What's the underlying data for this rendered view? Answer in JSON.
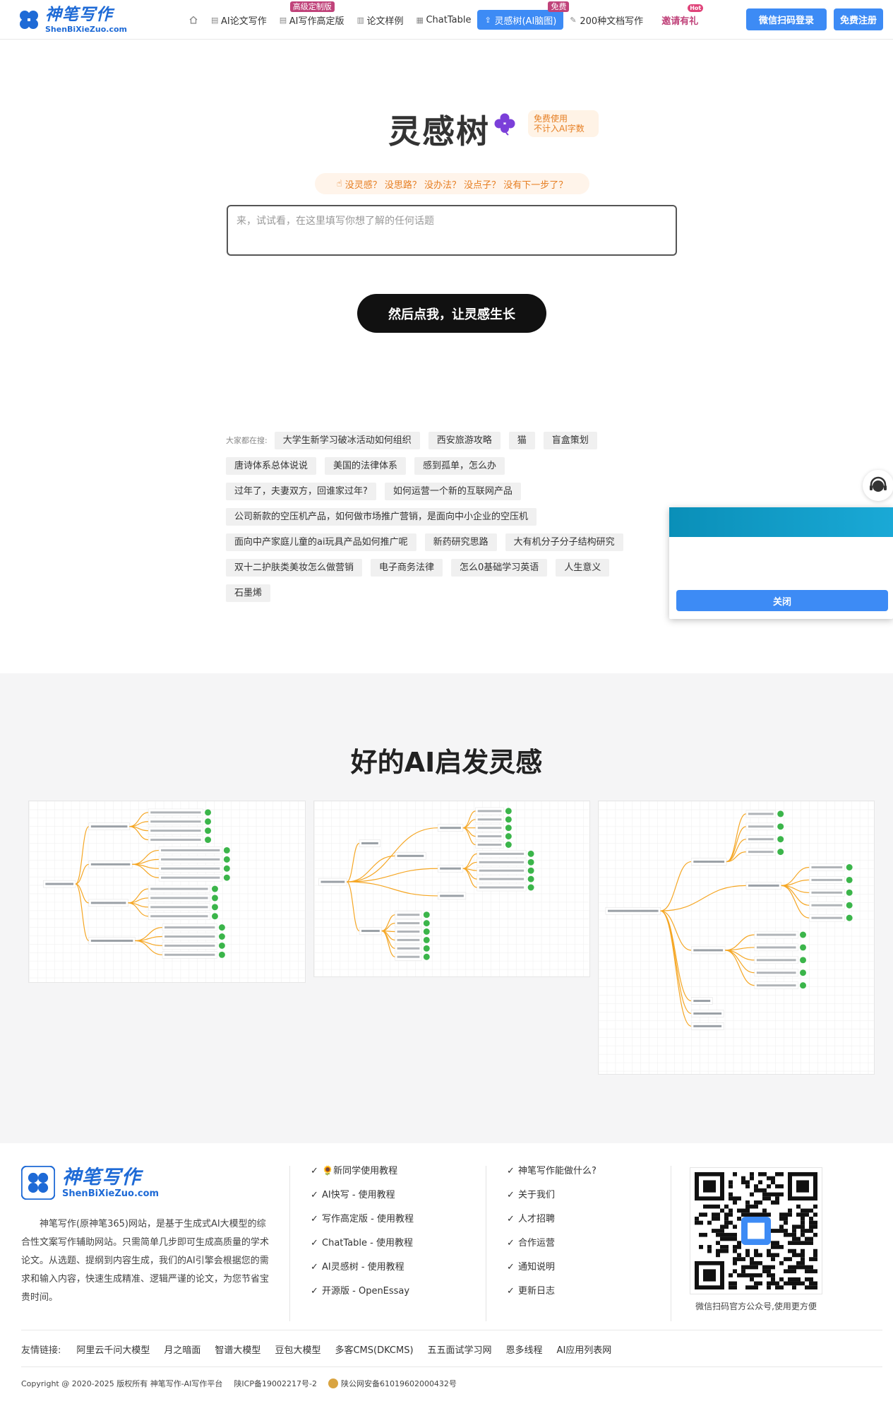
{
  "brand": {
    "name_cn": "神笔写作",
    "name_en": "ShenBiXieZuo.com"
  },
  "nav": {
    "items": [
      {
        "label": "AI论文写作",
        "icon": "document-icon"
      },
      {
        "label": "AI写作高定版",
        "icon": "document-icon",
        "badge": "高级定制版"
      },
      {
        "label": "论文样例",
        "icon": "book-icon"
      },
      {
        "label": "ChatTable",
        "icon": "table-icon"
      },
      {
        "label": "灵感树(AI脑图)",
        "icon": "upload-icon",
        "badge": "免费",
        "active": true
      },
      {
        "label": "200种文档写作",
        "icon": "pen-icon"
      }
    ],
    "invite": "邀请有礼",
    "invite_badge": "Hot",
    "login": "微信扫码登录",
    "register": "免费注册"
  },
  "hero": {
    "title": "灵感树",
    "badge_line1": "免费使用",
    "badge_line2": "不计入AI字数",
    "prompt": "没灵感？ 没思路？ 没办法？ 没点子？ 没有下一步了？",
    "input_placeholder": "来，试试看，在这里填写你想了解的任何话题",
    "submit": "然后点我，让灵感生长"
  },
  "search": {
    "label": "大家都在搜:",
    "rows": [
      [
        "大学生新学习破冰活动如何组织",
        "西安旅游攻略",
        "猫",
        "盲盒策划"
      ],
      [
        "唐诗体系总体说说",
        "美国的法律体系",
        "感到孤单，怎么办"
      ],
      [
        "过年了，夫妻双方，回谁家过年?",
        "如何运营一个新的互联网产品"
      ],
      [
        "公司新款的空压机产品，如何做市场推广营销，是面向中小企业的空压机"
      ],
      [
        "面向中产家庭儿童的ai玩具产品如何推广呢",
        "新药研究思路",
        "大有机分子分子结构研究"
      ],
      [
        "双十二护肤类美妆怎么做营销",
        "电子商务法律",
        "怎么0基础学习英语",
        "人生意义"
      ],
      [
        "石墨烯"
      ]
    ]
  },
  "popup": {
    "close": "关闭"
  },
  "inspire": {
    "title": "好的AI启发灵感"
  },
  "footer": {
    "about": "神笔写作(原神笔365)网站，是基于生成式AI大模型的综合性文案写作辅助网站。只需简单几步即可生成高质量的学术论文。从选题、提纲到内容生成，我们的AI引擎会根据您的需求和输入内容，快速生成精准、逻辑严谨的论文，为您节省宝贵时间。",
    "col1": [
      "🌻新同学使用教程",
      "AI快写 - 使用教程",
      "写作高定版 - 使用教程",
      "ChatTable - 使用教程",
      "AI灵感树 - 使用教程",
      "开源版 - OpenEssay"
    ],
    "col2": [
      "神笔写作能做什么?",
      "关于我们",
      "人才招聘",
      "合作运营",
      "通知说明",
      "更新日志"
    ],
    "qr_caption": "微信扫码官方公众号,使用更方便",
    "friend_label": "友情链接:",
    "friends": [
      "阿里云千问大模型",
      "月之暗面",
      "智谱大模型",
      "豆包大模型",
      "多客CMS(DKCMS)",
      "五五面试学习网",
      "恩多线程",
      "AI应用列表网"
    ],
    "copyright": "Copyright @ 2020-2025 版权所有 神笔写作-AI写作平台",
    "icp": "陕ICP备19002217号-2",
    "police": "陕公网安备61019602000432号"
  },
  "colors": {
    "primary": "#3d8bf5",
    "brand": "#1e6ad6",
    "accent_orange": "#e67e22",
    "badge_pink": "#c0437a",
    "node_green": "#3bb54a",
    "branch_orange": "#f5a623"
  }
}
